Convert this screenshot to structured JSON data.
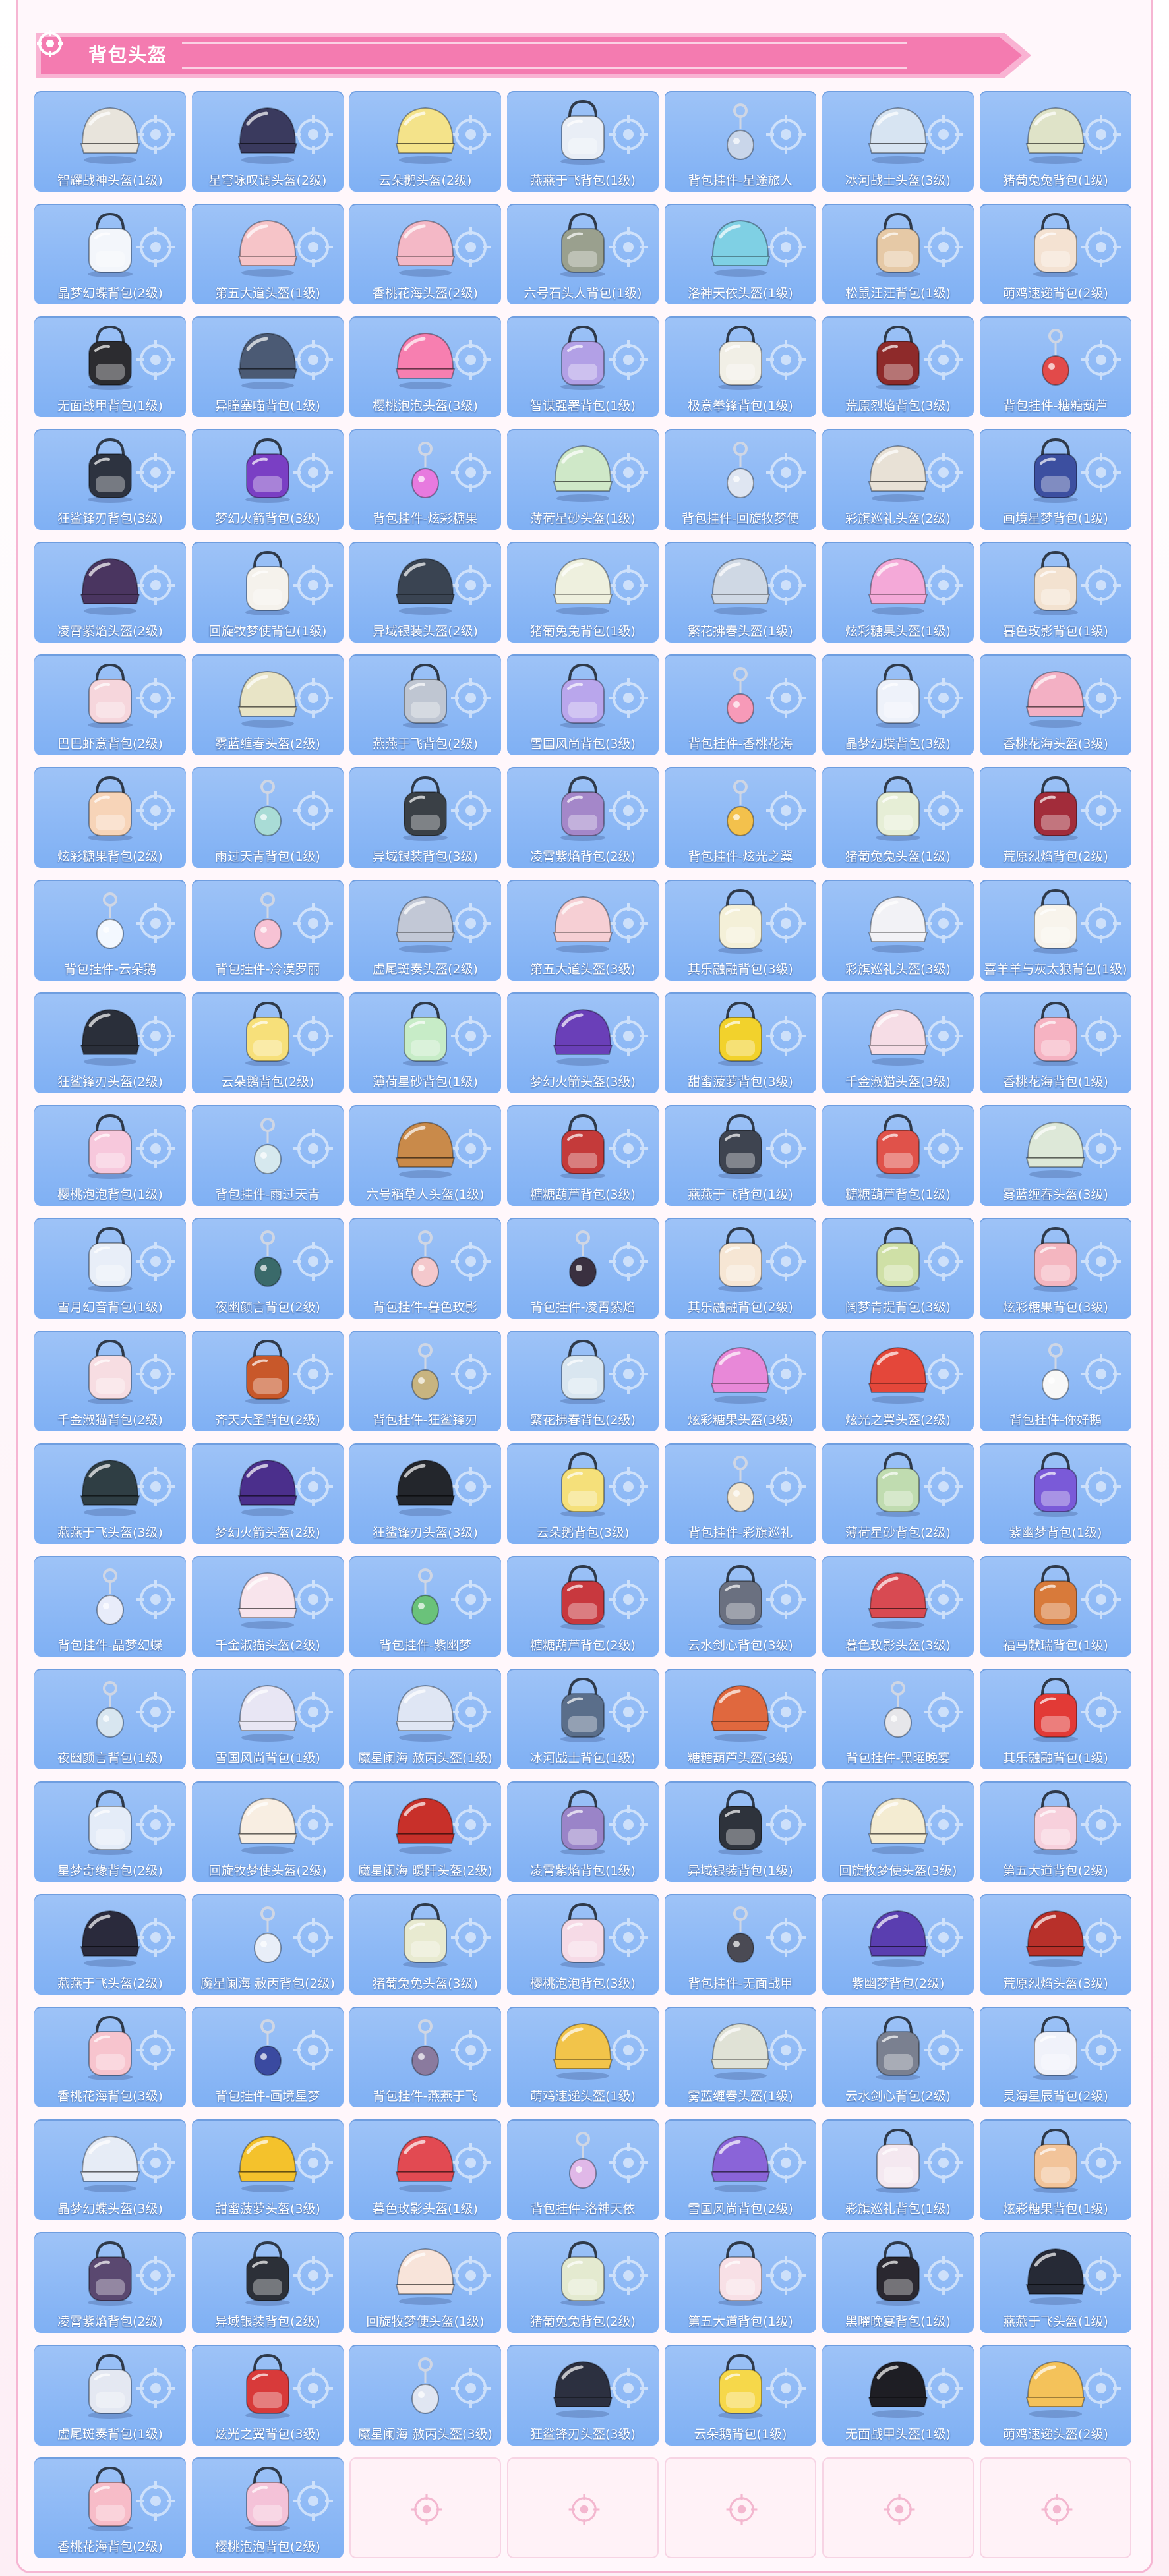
{
  "header": {
    "title": "背包头盔"
  },
  "colors": {
    "banner_pink": "#f47bb0",
    "banner_light": "#f9b3d3",
    "card_blue": "#8bb8f6",
    "empty_card": "#fff2f7",
    "frame_pink": "#f6b6d3"
  },
  "items": [
    {
      "name": "智耀战神头盔(1级)",
      "type": "helmet",
      "color": "#e8e4dc"
    },
    {
      "name": "星穹咏叹调头盔(2级)",
      "type": "helmet",
      "color": "#3a3a5e"
    },
    {
      "name": "云朵鹅头盔(2级)",
      "type": "helmet",
      "color": "#f4e38a"
    },
    {
      "name": "燕燕于飞背包(1级)",
      "type": "backpack",
      "color": "#e9eef6"
    },
    {
      "name": "背包挂件-星途旅人",
      "type": "charm",
      "color": "#c9d6ea"
    },
    {
      "name": "冰河战士头盔(3级)",
      "type": "helmet",
      "color": "#d7e4f2"
    },
    {
      "name": "猪葡兔兔背包(1级)",
      "type": "helmet",
      "color": "#dfe3c8"
    },
    {
      "name": "晶梦幻蝶背包(2级)",
      "type": "backpack",
      "color": "#f3f6fb"
    },
    {
      "name": "第五大道头盔(1级)",
      "type": "helmet",
      "color": "#f6c4c8"
    },
    {
      "name": "香桃花海头盔(2级)",
      "type": "helmet",
      "color": "#f4b8c6"
    },
    {
      "name": "六号石头人背包(1级)",
      "type": "backpack",
      "color": "#9aa08e"
    },
    {
      "name": "洛神天依头盔(1级)",
      "type": "helmet",
      "color": "#7fd0e4"
    },
    {
      "name": "松鼠汪汪背包(1级)",
      "type": "backpack",
      "color": "#e6c9a6"
    },
    {
      "name": "萌鸡速递背包(2级)",
      "type": "backpack",
      "color": "#f4e2d2"
    },
    {
      "name": "无面战甲背包(1级)",
      "type": "backpack",
      "color": "#2c2c30"
    },
    {
      "name": "异瞳塞喵背包(1级)",
      "type": "helmet",
      "color": "#4b5a74"
    },
    {
      "name": "樱桃泡泡头盔(3级)",
      "type": "helmet",
      "color": "#f77fb0"
    },
    {
      "name": "智谋强署背包(1级)",
      "type": "backpack",
      "color": "#b2a0e6"
    },
    {
      "name": "极意拳锋背包(1级)",
      "type": "backpack",
      "color": "#f1efe6"
    },
    {
      "name": "荒原烈焰背包(3级)",
      "type": "backpack",
      "color": "#8e2a2a"
    },
    {
      "name": "背包挂件-糖糖葫芦",
      "type": "charm",
      "color": "#e24a4a"
    },
    {
      "name": "狂鲨锋刃背包(3级)",
      "type": "backpack",
      "color": "#2d3340"
    },
    {
      "name": "梦幻火箭背包(3级)",
      "type": "backpack",
      "color": "#7a3fc4"
    },
    {
      "name": "背包挂件-炫彩糖果",
      "type": "charm",
      "color": "#e77adf"
    },
    {
      "name": "薄荷星砂头盔(1级)",
      "type": "helmet",
      "color": "#cfe8c8"
    },
    {
      "name": "背包挂件-回旋牧梦使",
      "type": "charm",
      "color": "#dfe6f2"
    },
    {
      "name": "彩旗巡礼头盔(2级)",
      "type": "helmet",
      "color": "#e8e1d6"
    },
    {
      "name": "画境星梦背包(1级)",
      "type": "backpack",
      "color": "#3c4fa0"
    },
    {
      "name": "凌霄紫焰头盔(2级)",
      "type": "helmet",
      "color": "#4a3560"
    },
    {
      "name": "回旋牧梦使背包(1级)",
      "type": "backpack",
      "color": "#f5f2ec"
    },
    {
      "name": "异域银装头盔(2级)",
      "type": "helmet",
      "color": "#3a4452"
    },
    {
      "name": "猪葡兔兔背包(1级)",
      "type": "helmet",
      "color": "#eef0de"
    },
    {
      "name": "繁花拂春头盔(1级)",
      "type": "helmet",
      "color": "#cfd8e4"
    },
    {
      "name": "炫彩糖果头盔(1级)",
      "type": "helmet",
      "color": "#f4a9d8"
    },
    {
      "name": "暮色玫影背包(1级)",
      "type": "backpack",
      "color": "#f3e2d0"
    },
    {
      "name": "巴巴虾意背包(2级)",
      "type": "backpack",
      "color": "#f6d6dc"
    },
    {
      "name": "雾蓝缠春头盔(2级)",
      "type": "helmet",
      "color": "#e8e4c6"
    },
    {
      "name": "燕燕于飞背包(2级)",
      "type": "backpack",
      "color": "#bfc6d2"
    },
    {
      "name": "雪国风尚背包(3级)",
      "type": "backpack",
      "color": "#b9a6ec"
    },
    {
      "name": "背包挂件-香桃花海",
      "type": "charm",
      "color": "#f79ab8"
    },
    {
      "name": "晶梦幻蝶背包(3级)",
      "type": "backpack",
      "color": "#eef2fa"
    },
    {
      "name": "香桃花海头盔(3级)",
      "type": "helmet",
      "color": "#f3b0c4"
    },
    {
      "name": "炫彩糖果背包(2级)",
      "type": "backpack",
      "color": "#f7d4b8"
    },
    {
      "name": "雨过天青背包(1级)",
      "type": "charm",
      "color": "#a9dcd6"
    },
    {
      "name": "异域银装背包(3级)",
      "type": "backpack",
      "color": "#3a4046"
    },
    {
      "name": "凌霄紫焰背包(2级)",
      "type": "backpack",
      "color": "#a487c9"
    },
    {
      "name": "背包挂件-炫光之翼",
      "type": "charm",
      "color": "#f3c14c"
    },
    {
      "name": "猪葡兔兔头盔(1级)",
      "type": "backpack",
      "color": "#e6eed6"
    },
    {
      "name": "荒原烈焰背包(2级)",
      "type": "backpack",
      "color": "#a22c3a"
    },
    {
      "name": "背包挂件-云朵鹅",
      "type": "charm",
      "color": "#f3f8ff"
    },
    {
      "name": "背包挂件-冷漠罗丽",
      "type": "charm",
      "color": "#f7c2d4"
    },
    {
      "name": "虚尾斑奏头盔(2级)",
      "type": "helmet",
      "color": "#c2c8d6"
    },
    {
      "name": "第五大道头盔(3级)",
      "type": "helmet",
      "color": "#f6cfd4"
    },
    {
      "name": "其乐融融背包(3级)",
      "type": "backpack",
      "color": "#f4f0d8"
    },
    {
      "name": "彩旗巡礼头盔(3级)",
      "type": "helmet",
      "color": "#f2f2f6"
    },
    {
      "name": "喜羊羊与灰太狼背包(1级)",
      "type": "backpack",
      "color": "#f8f4ec"
    },
    {
      "name": "狂鲨锋刃头盔(2级)",
      "type": "helmet",
      "color": "#2a2f3a"
    },
    {
      "name": "云朵鹅背包(2级)",
      "type": "backpack",
      "color": "#f7e07a"
    },
    {
      "name": "薄荷星砂背包(1级)",
      "type": "backpack",
      "color": "#c7ecc7"
    },
    {
      "name": "梦幻火箭头盔(3级)",
      "type": "helmet",
      "color": "#6a3fb8"
    },
    {
      "name": "甜蜜菠萝背包(3级)",
      "type": "backpack",
      "color": "#f2d22c"
    },
    {
      "name": "千金淑猫头盔(3级)",
      "type": "helmet",
      "color": "#f6dde6"
    },
    {
      "name": "香桃花海背包(1级)",
      "type": "backpack",
      "color": "#f6b3c2"
    },
    {
      "name": "樱桃泡泡背包(1级)",
      "type": "backpack",
      "color": "#f7c8dc"
    },
    {
      "name": "背包挂件-雨过天青",
      "type": "charm",
      "color": "#d6e8ee"
    },
    {
      "name": "六号稻草人头盔(1级)",
      "type": "helmet",
      "color": "#c98a4a"
    },
    {
      "name": "糖糖葫芦背包(3级)",
      "type": "backpack",
      "color": "#c43a3a"
    },
    {
      "name": "燕燕于飞背包(1级)",
      "type": "backpack",
      "color": "#3e4450"
    },
    {
      "name": "糖糖葫芦背包(1级)",
      "type": "backpack",
      "color": "#e0524a"
    },
    {
      "name": "雾蓝缠春头盔(3级)",
      "type": "helmet",
      "color": "#dde8d8"
    },
    {
      "name": "雪月幻音背包(1级)",
      "type": "backpack",
      "color": "#e8eef8"
    },
    {
      "name": "夜幽颜言背包(2级)",
      "type": "charm",
      "color": "#3a6a6a"
    },
    {
      "name": "背包挂件-暮色玫影",
      "type": "charm",
      "color": "#f4c8cc"
    },
    {
      "name": "背包挂件-凌霄紫焰",
      "type": "charm",
      "color": "#3a3040"
    },
    {
      "name": "其乐融融背包(2级)",
      "type": "backpack",
      "color": "#f6e6d4"
    },
    {
      "name": "阔梦青提背包(3级)",
      "type": "backpack",
      "color": "#cfe0a6"
    },
    {
      "name": "炫彩糖果背包(3级)",
      "type": "backpack",
      "color": "#f4b6c0"
    },
    {
      "name": "千金淑猫背包(2级)",
      "type": "backpack",
      "color": "#f7dde2"
    },
    {
      "name": "齐天大圣背包(2级)",
      "type": "backpack",
      "color": "#c8582a"
    },
    {
      "name": "背包挂件-狂鲨锋刃",
      "type": "charm",
      "color": "#c8b480"
    },
    {
      "name": "繁花拂春背包(2级)",
      "type": "backpack",
      "color": "#d9e6f0"
    },
    {
      "name": "炫彩糖果头盔(3级)",
      "type": "helmet",
      "color": "#e888d8"
    },
    {
      "name": "炫光之翼头盔(2级)",
      "type": "helmet",
      "color": "#e4473a"
    },
    {
      "name": "背包挂件-你好鹅",
      "type": "charm",
      "color": "#f8f8f8"
    },
    {
      "name": "燕燕于飞头盔(3级)",
      "type": "helmet",
      "color": "#2f3e44"
    },
    {
      "name": "梦幻火箭头盔(2级)",
      "type": "helmet",
      "color": "#4b2f8c"
    },
    {
      "name": "狂鲨锋刃头盔(3级)",
      "type": "helmet",
      "color": "#23262c"
    },
    {
      "name": "云朵鹅背包(3级)",
      "type": "backpack",
      "color": "#f5e07a"
    },
    {
      "name": "背包挂件-彩旗巡礼",
      "type": "charm",
      "color": "#f2e6d0"
    },
    {
      "name": "薄荷星砂背包(2级)",
      "type": "backpack",
      "color": "#c0dcb0"
    },
    {
      "name": "紫幽梦背包(1级)",
      "type": "backpack",
      "color": "#7a5ad8"
    },
    {
      "name": "背包挂件-晶梦幻蝶",
      "type": "charm",
      "color": "#e8ecfa"
    },
    {
      "name": "千金淑猫头盔(2级)",
      "type": "helmet",
      "color": "#f8e4ec"
    },
    {
      "name": "背包挂件-紫幽梦",
      "type": "charm",
      "color": "#6ac27a"
    },
    {
      "name": "糖糖葫芦背包(2级)",
      "type": "backpack",
      "color": "#c8383e"
    },
    {
      "name": "云水剑心背包(3级)",
      "type": "backpack",
      "color": "#6a7080"
    },
    {
      "name": "暮色玫影头盔(3级)",
      "type": "helmet",
      "color": "#d84a52"
    },
    {
      "name": "福马献瑞背包(1级)",
      "type": "backpack",
      "color": "#d87a3a"
    },
    {
      "name": "夜幽颜言背包(1级)",
      "type": "charm",
      "color": "#d8e6f0"
    },
    {
      "name": "雪国风尚背包(1级)",
      "type": "helmet",
      "color": "#e8e6f4"
    },
    {
      "name": "魔星阑海 赦丙头盔(1级)",
      "type": "helmet",
      "color": "#dfe6f4"
    },
    {
      "name": "冰河战士背包(1级)",
      "type": "backpack",
      "color": "#5a6e8a"
    },
    {
      "name": "糖糖葫芦头盔(3级)",
      "type": "helmet",
      "color": "#e0683e"
    },
    {
      "name": "背包挂件-黑曜晚宴",
      "type": "charm",
      "color": "#e6e6ea"
    },
    {
      "name": "其乐融融背包(1级)",
      "type": "backpack",
      "color": "#e23a36"
    },
    {
      "name": "星梦奇缘背包(2级)",
      "type": "backpack",
      "color": "#e4ecf8"
    },
    {
      "name": "回旋牧梦使头盔(2级)",
      "type": "helmet",
      "color": "#f8eee2"
    },
    {
      "name": "魔星阑海 暖阡头盔(2级)",
      "type": "helmet",
      "color": "#c8302a"
    },
    {
      "name": "凌霄紫焰背包(1级)",
      "type": "backpack",
      "color": "#9a84c8"
    },
    {
      "name": "异域银装背包(1级)",
      "type": "backpack",
      "color": "#2e333c"
    },
    {
      "name": "回旋牧梦使头盔(3级)",
      "type": "helmet",
      "color": "#f4ecd2"
    },
    {
      "name": "第五大道背包(2级)",
      "type": "backpack",
      "color": "#f7d0dc"
    },
    {
      "name": "燕燕于飞头盔(2级)",
      "type": "helmet",
      "color": "#2a2a3c"
    },
    {
      "name": "魔星阑海 赦丙背包(2级)",
      "type": "charm",
      "color": "#e8eef8"
    },
    {
      "name": "猪葡兔兔头盔(3级)",
      "type": "backpack",
      "color": "#e8ead0"
    },
    {
      "name": "樱桃泡泡背包(3级)",
      "type": "backpack",
      "color": "#f6dae6"
    },
    {
      "name": "背包挂件-无面战甲",
      "type": "charm",
      "color": "#4a4a54"
    },
    {
      "name": "紫幽梦背包(2级)",
      "type": "helmet",
      "color": "#5a3eb0"
    },
    {
      "name": "荒原烈焰头盔(3级)",
      "type": "helmet",
      "color": "#b8302a"
    },
    {
      "name": "香桃花海背包(3级)",
      "type": "backpack",
      "color": "#f7c4ce"
    },
    {
      "name": "背包挂件-画境星梦",
      "type": "charm",
      "color": "#3a4aa0"
    },
    {
      "name": "背包挂件-燕燕于飞",
      "type": "charm",
      "color": "#8a7a9e"
    },
    {
      "name": "萌鸡速递头盔(1级)",
      "type": "helmet",
      "color": "#f2c44a"
    },
    {
      "name": "雾蓝缠春头盔(1级)",
      "type": "helmet",
      "color": "#e0e2d6"
    },
    {
      "name": "云水剑心背包(2级)",
      "type": "backpack",
      "color": "#7a8090"
    },
    {
      "name": "灵海星辰背包(2级)",
      "type": "backpack",
      "color": "#f0f2fa"
    },
    {
      "name": "晶梦幻蝶头盔(3级)",
      "type": "helmet",
      "color": "#e6ecf6"
    },
    {
      "name": "甜蜜菠萝头盔(3级)",
      "type": "helmet",
      "color": "#f4c22c"
    },
    {
      "name": "暮色玫影头盔(1级)",
      "type": "helmet",
      "color": "#e24a52"
    },
    {
      "name": "背包挂件-洛神天依",
      "type": "charm",
      "color": "#e0b8e8"
    },
    {
      "name": "雪国风尚背包(2级)",
      "type": "helmet",
      "color": "#8a64d8"
    },
    {
      "name": "彩旗巡礼背包(1级)",
      "type": "backpack",
      "color": "#f4e8f0"
    },
    {
      "name": "炫彩糖果背包(1级)",
      "type": "backpack",
      "color": "#f2c49a"
    },
    {
      "name": "凌霄紫焰背包(2级)",
      "type": "backpack",
      "color": "#5a4870"
    },
    {
      "name": "异域银装背包(2级)",
      "type": "backpack",
      "color": "#2c3038"
    },
    {
      "name": "回旋牧梦使头盔(1级)",
      "type": "helmet",
      "color": "#f8e4da"
    },
    {
      "name": "猪葡兔兔背包(2级)",
      "type": "backpack",
      "color": "#e4ead0"
    },
    {
      "name": "第五大道背包(1级)",
      "type": "backpack",
      "color": "#f8e0e6"
    },
    {
      "name": "黑曜晚宴背包(1级)",
      "type": "backpack",
      "color": "#2a2830"
    },
    {
      "name": "燕燕于飞头盔(1级)",
      "type": "helmet",
      "color": "#262a36"
    },
    {
      "name": "虚尾斑奏背包(1级)",
      "type": "backpack",
      "color": "#e4e8f2"
    },
    {
      "name": "炫光之翼背包(3级)",
      "type": "backpack",
      "color": "#d83a3a"
    },
    {
      "name": "魔星阑海 赦丙头盔(3级)",
      "type": "charm",
      "color": "#e0e6f2"
    },
    {
      "name": "狂鲨锋刃头盔(3级)",
      "type": "helmet",
      "color": "#2c3040"
    },
    {
      "name": "云朵鹅背包(1级)",
      "type": "backpack",
      "color": "#f6d84a"
    },
    {
      "name": "无面战甲头盔(1级)",
      "type": "helmet",
      "color": "#1e1e24"
    },
    {
      "name": "萌鸡速递头盔(2级)",
      "type": "helmet",
      "color": "#f4c25a"
    },
    {
      "name": "香桃花海背包(2级)",
      "type": "backpack",
      "color": "#f7bcc8"
    },
    {
      "name": "樱桃泡泡背包(2级)",
      "type": "backpack",
      "color": "#f4c2d8"
    }
  ],
  "empty_slots": 5
}
